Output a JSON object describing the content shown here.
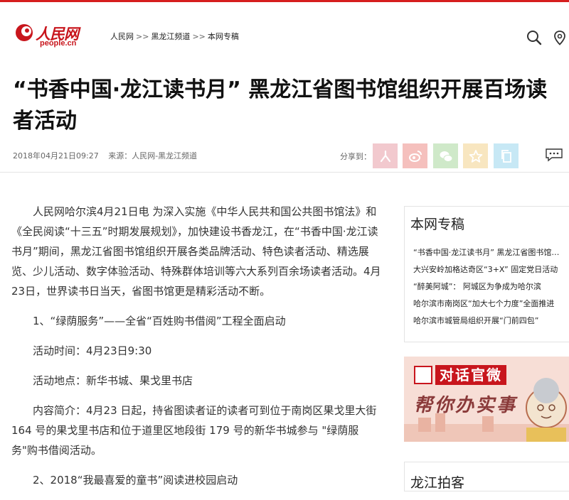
{
  "logo": {
    "cn": "人民网",
    "en": "people.cn"
  },
  "breadcrumb": [
    "人民网",
    "黑龙江频道",
    "本网专稿"
  ],
  "breadcrumb_sep": ">>",
  "header_icons": [
    "search-icon",
    "location-icon"
  ],
  "article": {
    "title": "“书香中国·龙江读书月” 黑龙江省图书馆组织开展百场读者活动",
    "datetime": "2018年04月21日09:27",
    "source": "来源：人民网-黑龙江频道",
    "share_label": "分享到：",
    "share_buttons": [
      {
        "name": "people",
        "color": "#f2c9ce"
      },
      {
        "name": "weibo",
        "color": "#f5c0bd"
      },
      {
        "name": "wechat",
        "color": "#cfe9c9"
      },
      {
        "name": "qzone",
        "color": "#f8e6c0"
      },
      {
        "name": "copy",
        "color": "#c7e8f5"
      }
    ],
    "paragraphs": [
      "人民网哈尔滨4月21日电 为深入实施《中华人民共和国公共图书馆法》和《全民阅读“十三五”时期发展规划》，加快建设书香龙江，在“书香中国·龙江读书月”期间，黑龙江省图书馆组织开展各类品牌活动、特色读者活动、精选展览、少儿活动、数字体验活动、特殊群体培训等六大系列百余场读者活动。4月23日，世界读书日当天，省图书馆更是精彩活动不断。",
      "1、“绿荫服务”——全省“百姓购书借阅”工程全面启动",
      "活动时间：4月23日9:30",
      "活动地点：新华书城、果戈里书店",
      "内容简介：4月23 日起，持省图读者证的读者可到位于南岗区果戈里大街 164 号的果戈里书店和位于道里区地段街 179 号的新华书城参与 \"绿荫服务\"购书借阅活动。",
      "2、2018“我最喜爱的童书”阅读进校园启动"
    ]
  },
  "sidebar": {
    "section_title": "本网专稿",
    "links": [
      "“书香中国·龙江读书月” 黑龙江省图书馆组织开展百场读者活动",
      "大兴安岭加格达奇区“3+X” 固定党日活动",
      "“醉美阿城”： 阿城区为争成为哈尔滨",
      "哈尔滨市南岗区“加大七个力度”全面推进",
      "哈尔滨市城管局组织开展“门前四包”"
    ],
    "banner": {
      "line1": "对话官微",
      "line2": "帮你办实事"
    },
    "section2_title": "龙江拍客"
  },
  "colors": {
    "brand_red": "#c8161d",
    "top_line": "#d61e1e"
  }
}
